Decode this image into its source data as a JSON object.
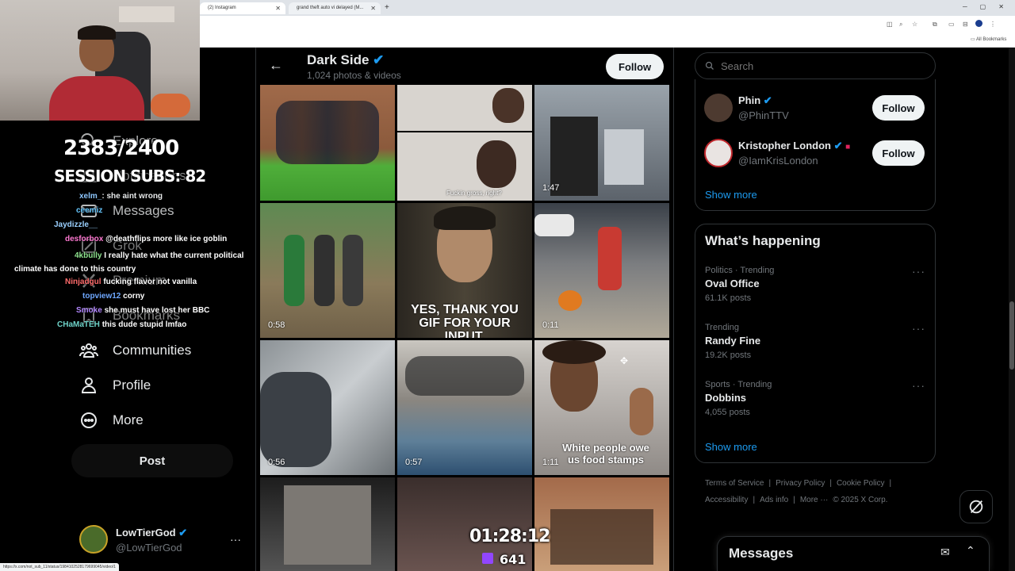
{
  "browser": {
    "tabs": [
      {
        "title": "(2) Instagram"
      },
      {
        "title": "grand theft auto vi delayed (M..."
      }
    ],
    "new_tab": "+",
    "bookmarks_label": "All Bookmarks",
    "status_url": "https://x.com/not_sub_11/status/1984102528179699045/video/1"
  },
  "overlay": {
    "counter": "2383/2400",
    "session": "SESSION SUBS: 82",
    "chat": [
      {
        "user": "xelm_",
        "message": "she aint wrong",
        "color": "#8ec7ff"
      },
      {
        "user": "ceemiz",
        "message": "",
        "color": "#67c8ff"
      },
      {
        "user": "Jaydizzle__",
        "message": "",
        "color": "#9ad0ff"
      },
      {
        "user": "desforbox",
        "message": "@deathflips more like ice goblin",
        "color": "#ff79d2"
      },
      {
        "user": "4kbully",
        "message": "I really hate what the current political climate has done to this country",
        "color": "#8fe38f"
      },
      {
        "user": "Ninjadgul",
        "message": "fucking flavor not vanilla",
        "color": "#ff6b6b"
      },
      {
        "user": "topview12",
        "message": "corny",
        "color": "#6fa8ff"
      },
      {
        "user": "Smoke",
        "message": "she must have lost her BBC",
        "color": "#b388ff"
      },
      {
        "user": "CHaMaTEH",
        "message": "this dude stupid lmfao",
        "color": "#6ed2c8"
      }
    ],
    "stream_time": "01:28:12",
    "viewers": "641"
  },
  "sidebar": {
    "items": [
      {
        "label": "Explore",
        "icon": "search-icon"
      },
      {
        "label": "Notifications",
        "icon": "bell-icon"
      },
      {
        "label": "Messages",
        "icon": "mail-icon"
      },
      {
        "label": "Grok",
        "icon": "grok-icon"
      },
      {
        "label": "Premium",
        "icon": "x-logo-icon"
      },
      {
        "label": "Bookmarks",
        "icon": "bookmark-icon"
      },
      {
        "label": "Communities",
        "icon": "people-icon"
      },
      {
        "label": "Profile",
        "icon": "person-icon"
      },
      {
        "label": "More",
        "icon": "more-circle-icon"
      }
    ],
    "post_label": "Post",
    "account": {
      "name": "LowTierGod",
      "handle": "@LowTierGod"
    }
  },
  "main": {
    "header": {
      "name": "Dark Side",
      "count": "1,024 photos & videos",
      "follow_label": "Follow"
    },
    "media": [
      {
        "duration": "",
        "caption": ""
      },
      {
        "duration": "",
        "caption": "Fuckin gross, right?"
      },
      {
        "duration": "1:47",
        "caption": ""
      },
      {
        "duration": "0:58",
        "caption": ""
      },
      {
        "duration": "",
        "caption": "YES, THANK YOU\nGIF FOR YOUR INPUT."
      },
      {
        "duration": "0:11",
        "caption": ""
      },
      {
        "duration": "0:56",
        "caption": ""
      },
      {
        "duration": "0:57",
        "caption": ""
      },
      {
        "duration": "1:11",
        "caption": "White people owe\nus food stamps"
      },
      {
        "duration": "",
        "caption": ""
      },
      {
        "duration": "",
        "caption": ""
      },
      {
        "duration": "",
        "caption": ""
      }
    ]
  },
  "right": {
    "search_placeholder": "Search",
    "who_to_follow": [
      {
        "name": "Phin",
        "handle": "@PhinTTV",
        "follow": "Follow"
      },
      {
        "name": "Kristopher London",
        "handle": "@IamKrisLondon",
        "follow": "Follow"
      }
    ],
    "show_more": "Show more",
    "happening_title": "What’s happening",
    "trends": [
      {
        "meta": "Politics · Trending",
        "name": "Oval Office",
        "posts": "61.1K posts"
      },
      {
        "meta": "Trending",
        "name": "Randy Fine",
        "posts": "19.2K posts"
      },
      {
        "meta": "Sports · Trending",
        "name": "Dobbins",
        "posts": "4,055 posts"
      }
    ],
    "show_more_2": "Show more",
    "footer": {
      "terms": "Terms of Service",
      "privacy": "Privacy Policy",
      "cookie": "Cookie Policy",
      "accessibility": "Accessibility",
      "ads": "Ads info",
      "more": "More ···",
      "copyright": "© 2025 X Corp."
    },
    "messages_label": "Messages"
  },
  "colors": {
    "accent": "#1d9bf0",
    "bg": "#000000",
    "border": "#2f3336",
    "muted": "#71767b"
  }
}
